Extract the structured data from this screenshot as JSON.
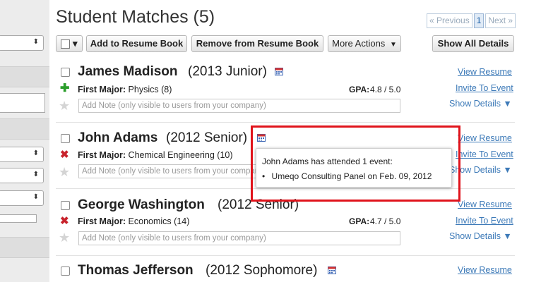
{
  "header": {
    "title": "Student Matches (5)",
    "pager": {
      "prev": "« Previous",
      "current": "1",
      "next": "Next »"
    }
  },
  "toolbar": {
    "select_arrow": "▾",
    "add": "Add to Resume Book",
    "remove": "Remove from Resume Book",
    "more": "More Actions",
    "more_arrow": "▼",
    "show_all": "Show All Details"
  },
  "sidebar": {
    "select_arrow": "⬍"
  },
  "students": [
    {
      "name": "James Madison",
      "class": "(2013 Junior)",
      "major_label": "First Major:",
      "major": "Physics (8)",
      "major_status": "plus",
      "gpa_label": "GPA:",
      "gpa": "4.8 / 5.0",
      "note_placeholder": "Add Note (only visible to users from your company)",
      "view": "View Resume",
      "invite": "Invite To Event",
      "details": "Show Details ▼"
    },
    {
      "name": "John Adams",
      "class": "(2012 Senior)",
      "major_label": "First Major:",
      "major": "Chemical Engineering (10)",
      "major_status": "x",
      "gpa_label": "",
      "gpa": "",
      "note_placeholder": "Add Note (only visible to users from your company)",
      "view": "View Resume",
      "invite": "Invite To Event",
      "details": "Show Details ▼"
    },
    {
      "name": "George Washington",
      "class": "(2012 Senior)",
      "major_label": "First Major:",
      "major": "Economics (14)",
      "major_status": "x",
      "gpa_label": "GPA:",
      "gpa": "4.7 / 5.0",
      "note_placeholder": "Add Note (only visible to users from your company)",
      "view": "View Resume",
      "invite": "Invite To Event",
      "details": "Show Details ▼"
    },
    {
      "name": "Thomas Jefferson",
      "class": "(2012 Sophomore)",
      "view": "View Resume"
    }
  ],
  "tooltip": {
    "line1": "John Adams has attended 1 event:",
    "line2": "Umeqo Consulting Panel on Feb. 09, 2012",
    "bullet": "•"
  },
  "icons": {
    "plus": "✚",
    "x": "✖",
    "star": "★"
  },
  "colors": {
    "highlight": "#e0131b",
    "link": "#3d7ab8",
    "plus": "#2a9d2a",
    "x": "#c8232c"
  }
}
